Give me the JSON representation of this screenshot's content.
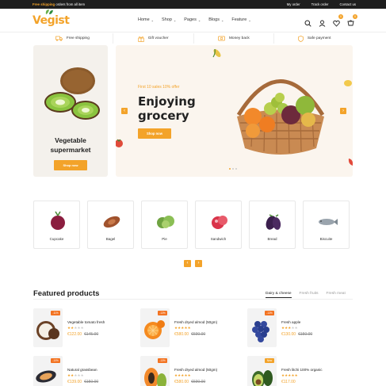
{
  "topbar": {
    "promo_highlight": "Free shipping",
    "promo_rest": " orders from all item",
    "links": [
      "My order",
      "Track order",
      "Contact us"
    ]
  },
  "header": {
    "logo": "Vegist",
    "nav": [
      "Home",
      "Shop",
      "Pages",
      "Blogs",
      "Feature"
    ],
    "wishlist_count": "0",
    "cart_count": "0"
  },
  "services": [
    "Free shipping",
    "Gift voucher",
    "Money back",
    "Safe payment"
  ],
  "side_banner": {
    "title_line1": "Vegetable",
    "title_line2": "supermarket",
    "button": "Shop now"
  },
  "hero": {
    "subtitle": "First 10 sales 10% offer",
    "title_line1": "Enjoying",
    "title_line2": "grocery",
    "button": "Shop now",
    "prev": "‹",
    "next": "›"
  },
  "categories": [
    "Cupcake",
    "Bagel",
    "Pie",
    "Sandwich",
    "Bread",
    "Biscuite"
  ],
  "category_nav": {
    "prev": "‹",
    "next": "›"
  },
  "featured": {
    "title": "Featured products",
    "tabs": [
      "Dairy & cheese",
      "Fresh fruits",
      "Fresh meat"
    ],
    "products": [
      {
        "name": "Vegetable tomato fresh",
        "tag": "-11%",
        "rating": 2,
        "price": "€122.00",
        "old_price": "€145.00",
        "icon": "coconut-icon"
      },
      {
        "name": "Fresh dryed almod (50gm)",
        "tag": "-13%",
        "rating": 5,
        "price": "€580.00",
        "old_price": "€690.00",
        "icon": "orange-icon"
      },
      {
        "name": "Fresh apple",
        "tag": "-13%",
        "rating": 3,
        "price": "€130.00",
        "old_price": "€150.00",
        "icon": "grapes-icon"
      },
      {
        "name": "Natural grassbean",
        "tag": "-10%",
        "rating": 2,
        "price": "€139.00",
        "old_price": "€150.00",
        "icon": "mussel-icon"
      },
      {
        "name": "Fresh dryed almod (50gm)",
        "tag": "-13%",
        "rating": 5,
        "price": "€580.00",
        "old_price": "€690.00",
        "icon": "papaya-icon"
      },
      {
        "name": "Fresh litchi 100% organic",
        "tag": "New",
        "rating": 5,
        "price": "€117.00",
        "old_price": "",
        "icon": "avocado-icon"
      }
    ]
  },
  "colors": {
    "accent": "#f3a32a",
    "topbar": "#1e1e1e",
    "hero_bg": "#fbf5ee",
    "sale_tag": "#f37321"
  }
}
